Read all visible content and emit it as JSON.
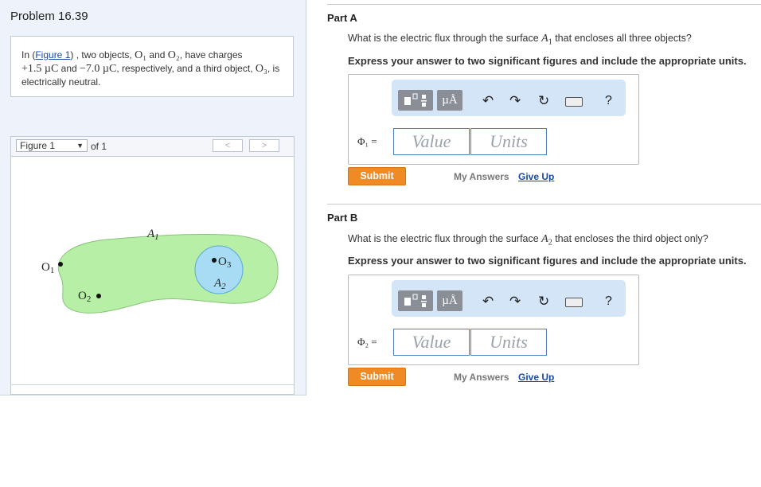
{
  "problem": {
    "title": "Problem 16.39",
    "intro": {
      "prefix": "In (",
      "figure_link": "Figure 1",
      "text_a": ") , two objects, ",
      "o1": "O₁",
      "text_b": " and ",
      "o2": "O₂",
      "text_c": ", have charges",
      "charge1": "+1.5 µC",
      "text_d": " and ",
      "charge2": "−7.0 µC",
      "text_e": ", respectively, and a third object, ",
      "o3": "O₃",
      "text_f": ", is electrically neutral."
    }
  },
  "figure": {
    "selector": "Figure 1",
    "of_label": "of 1",
    "prev": "<",
    "next": ">",
    "labels": {
      "a1": "A",
      "a1_sub": "1",
      "a2": "A",
      "a2_sub": "2",
      "o1": "O",
      "o1_sub": "1",
      "o2": "O",
      "o2_sub": "2",
      "o3": "O",
      "o3_sub": "3"
    },
    "colors": {
      "a1_fill": "#b6efa5",
      "a2_fill": "#a8dcf5"
    }
  },
  "parts": [
    {
      "title": "Part A",
      "question_pre": "What is the electric flux through the surface ",
      "surface": "A",
      "surface_sub": "1",
      "question_post": " that encloses all three objects?",
      "instruction": "Express your answer to two significant figures and include the appropriate units.",
      "phi_label": "Φ₁ =",
      "value_placeholder": "Value",
      "units_placeholder": "Units",
      "submit": "Submit",
      "my_answers": "My Answers",
      "give_up": "Give Up"
    },
    {
      "title": "Part B",
      "question_pre": "What is the electric flux through the surface ",
      "surface": "A",
      "surface_sub": "2",
      "question_post": " that encloses the third object only?",
      "instruction": "Express your answer to two significant figures and include the appropriate units.",
      "phi_label": "Φ₂ =",
      "value_placeholder": "Value",
      "units_placeholder": "Units",
      "submit": "Submit",
      "my_answers": "My Answers",
      "give_up": "Give Up"
    }
  ],
  "toolbar": {
    "units_button": "µÅ",
    "undo_icon": "undo-icon",
    "redo_icon": "redo-icon",
    "reset_icon": "reset-icon",
    "keyboard_icon": "keyboard-icon",
    "help": "?"
  }
}
